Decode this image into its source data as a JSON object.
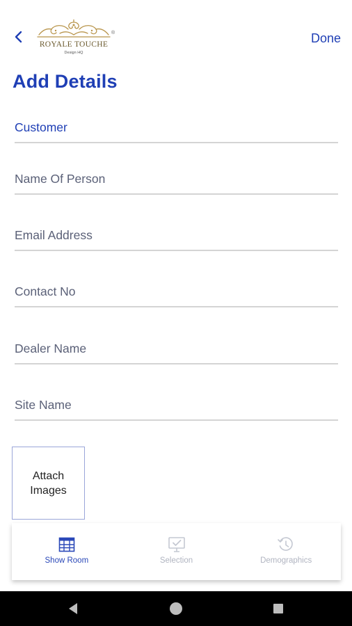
{
  "header": {
    "back_icon": "chevron-left-icon",
    "logo": {
      "name": "ROYALE TOUCHE",
      "sub": "Design HQ",
      "reg": "®"
    },
    "done_label": "Done"
  },
  "page": {
    "title": "Add Details"
  },
  "form": {
    "fields": [
      {
        "label": "Customer",
        "active": true
      },
      {
        "label": "Name Of Person"
      },
      {
        "label": "Email Address"
      },
      {
        "label": "Contact No"
      },
      {
        "label": "Dealer Name"
      },
      {
        "label": "Site Name"
      }
    ],
    "attach": {
      "line1": "Attach",
      "line2": "Images"
    }
  },
  "bottom_nav": {
    "items": [
      {
        "label": "Show Room",
        "icon": "showroom-icon",
        "active": true
      },
      {
        "label": "Selection",
        "icon": "selection-icon"
      },
      {
        "label": "Demographics",
        "icon": "history-icon"
      }
    ]
  },
  "colors": {
    "accent": "#1f3fb5",
    "field_text": "#5b6178",
    "underline": "#d4d4d4",
    "inactive": "#b0b4c0"
  }
}
